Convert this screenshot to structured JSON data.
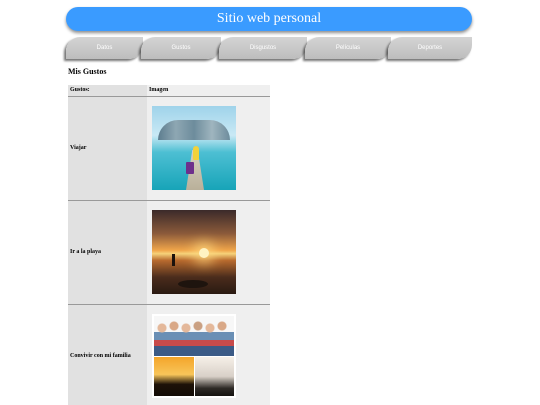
{
  "header": {
    "title": "Sitio web personal",
    "color": "#3a9bff"
  },
  "nav": {
    "tabs": [
      {
        "label": "Datos"
      },
      {
        "label": "Gustos"
      },
      {
        "label": "Disgustos"
      },
      {
        "label": "Películas"
      },
      {
        "label": "Deportes"
      }
    ]
  },
  "section": {
    "title": "Mis Gustos"
  },
  "table": {
    "headers": [
      "Gustos:",
      "Imagen"
    ],
    "rows": [
      {
        "name": "Viajar",
        "image": "travel-photo"
      },
      {
        "name": "Ir a la playa",
        "image": "beach-sunset-photo"
      },
      {
        "name": "Convivir con mi familia",
        "image": "family-collage-photo"
      }
    ]
  }
}
